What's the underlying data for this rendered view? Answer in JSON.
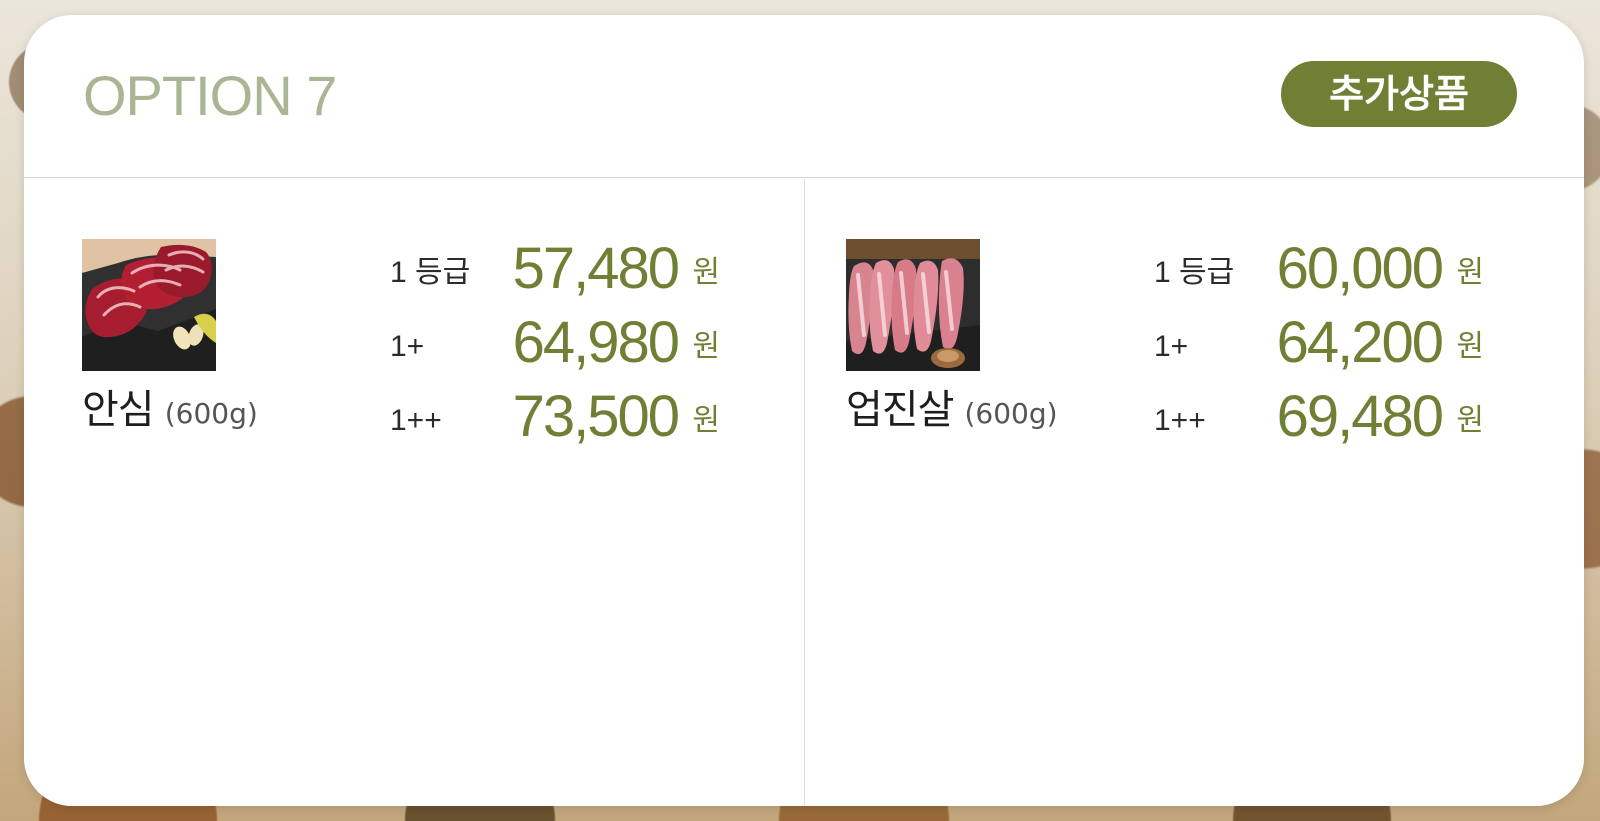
{
  "option": {
    "title": "OPTION 7",
    "badge": "추가상품"
  },
  "products": [
    {
      "name": "안심",
      "weight": "(600g)",
      "image_icon": "beef-tenderloin-image",
      "prices": [
        {
          "grade": "1 등급",
          "price": "57,480",
          "unit": "원"
        },
        {
          "grade": "1+",
          "price": "64,980",
          "unit": "원"
        },
        {
          "grade": "1++",
          "price": "73,500",
          "unit": "원"
        }
      ]
    },
    {
      "name": "업진살",
      "weight": "(600g)",
      "image_icon": "beef-brisket-image",
      "prices": [
        {
          "grade": "1 등급",
          "price": "60,000",
          "unit": "원"
        },
        {
          "grade": "1+",
          "price": "64,200",
          "unit": "원"
        },
        {
          "grade": "1++",
          "price": "69,480",
          "unit": "원"
        }
      ]
    }
  ],
  "colors": {
    "accent": "#6f7f34",
    "title_green": "#aab593",
    "divider": "#d7d7d7"
  }
}
